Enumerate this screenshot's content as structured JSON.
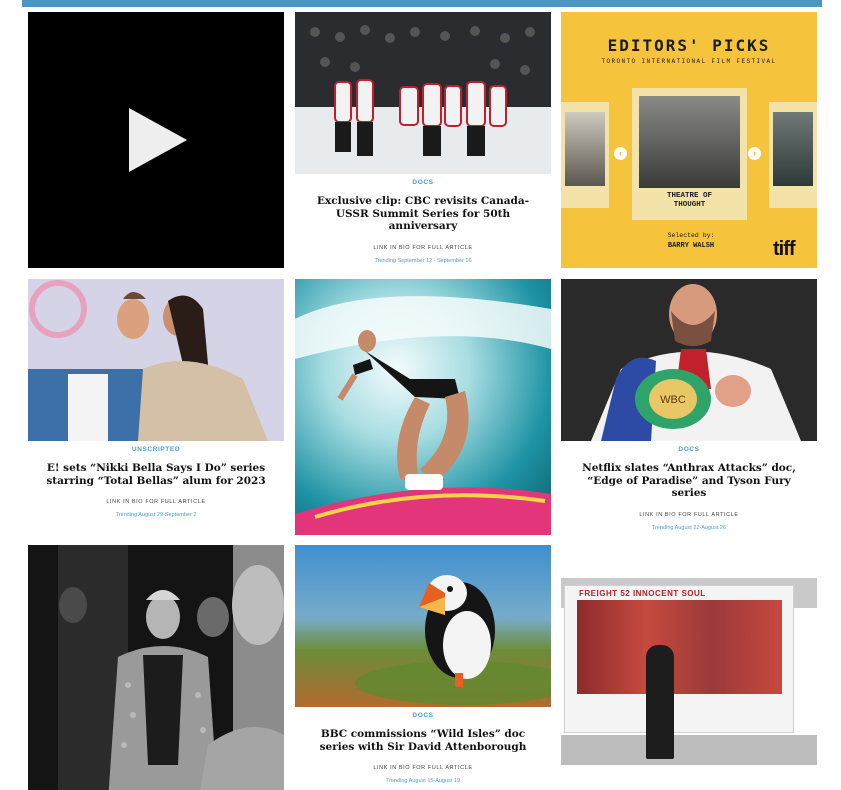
{
  "page": {
    "accent_color": "#4a97c6",
    "tag_color": "#4a9fd8"
  },
  "tiles": [
    {
      "type": "video",
      "icon": "play-icon"
    },
    {
      "type": "article",
      "image": "hockey-celebration-photo",
      "tag": "DOCS",
      "headline": "Exclusive clip: CBC revisits Canada-USSR Summit Series for 50th anniversary",
      "link_text": "LINK IN BIO FOR FULL ARTICLE",
      "trending": "Trending September 12 - September 16"
    },
    {
      "type": "editors_picks",
      "title": "EDITORS' PICKS",
      "subtitle": "TORONTO INTERNATIONAL FILM FESTIVAL",
      "card_caption_line1": "THEATRE OF",
      "card_caption_line2": "THOUGHT",
      "selected_by": "Selected by:",
      "selector_name": "BARRY WALSH",
      "logo": "tiff",
      "prev_icon": "chevron-left-icon",
      "next_icon": "chevron-right-icon",
      "brand_color": "#f6c43c"
    },
    {
      "type": "article",
      "image": "couple-kiss-photo",
      "tag": "UNSCRIPTED",
      "headline": "E! sets “Nikki Bella Says I Do” series starring “Total Bellas” alum for 2023",
      "link_text": "LINK IN BIO FOR FULL ARTICLE",
      "trending": "Trending August 29-September 2"
    },
    {
      "type": "photo",
      "image": "surfer-photo"
    },
    {
      "type": "article",
      "image": "boxer-with-belt-photo",
      "tag": "DOCS",
      "headline": "Netflix slates “Anthrax Attacks” doc, “Edge of Paradise” and Tyson Fury series",
      "link_text": "LINK IN BIO FOR FULL ARTICLE",
      "trending": "Trending August 22-August 26"
    },
    {
      "type": "photo",
      "image": "performer-backstage-photo"
    },
    {
      "type": "article",
      "image": "puffin-photo",
      "tag": "DOCS",
      "headline": "BBC commissions “Wild Isles” doc series with Sir David Attenborough",
      "link_text": "LINK IN BIO FOR FULL ARTICLE",
      "trending": "Trending August 15-August 19"
    },
    {
      "type": "photo",
      "image": "truck-billboard-photo",
      "visible_text": "FREIGHT 52 INNOCENT SOUL"
    }
  ]
}
